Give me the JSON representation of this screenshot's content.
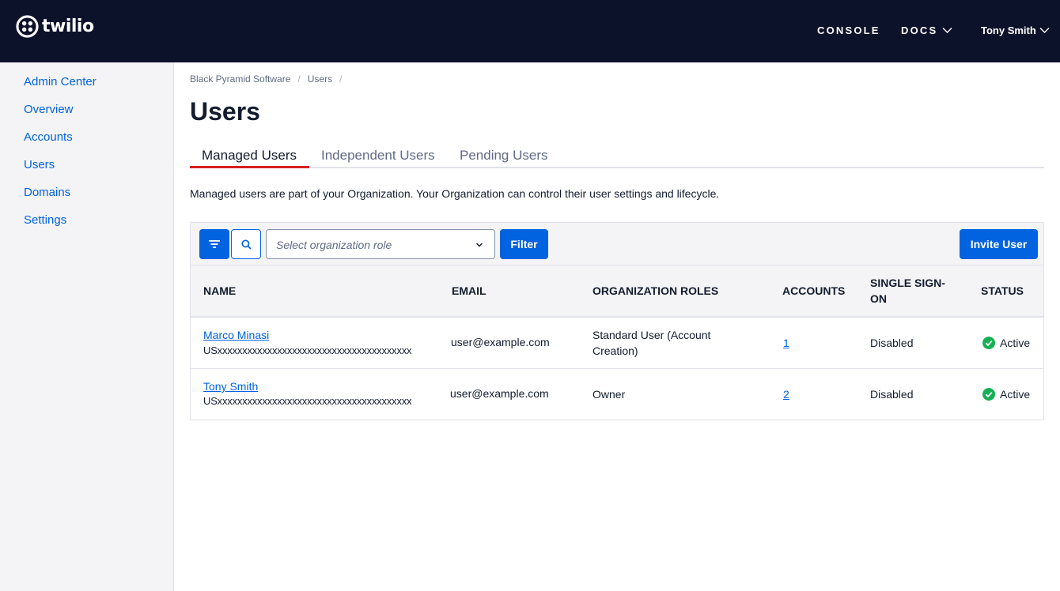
{
  "header": {
    "brand": "twilio",
    "nav": {
      "console": "CONSOLE",
      "docs": "DOCS",
      "user": "Tony Smith"
    }
  },
  "sidebar": {
    "items": [
      {
        "label": "Admin Center"
      },
      {
        "label": "Overview"
      },
      {
        "label": "Accounts"
      },
      {
        "label": "Users"
      },
      {
        "label": "Domains"
      },
      {
        "label": "Settings"
      }
    ]
  },
  "breadcrumb": {
    "items": [
      "Black Pyramid Software",
      "Users"
    ],
    "separator": "/"
  },
  "page": {
    "title": "Users",
    "description": "Managed users are part of your Organization. Your Organization can control their user settings and lifecycle."
  },
  "tabs": [
    {
      "label": "Managed Users",
      "active": true
    },
    {
      "label": "Independent Users",
      "active": false
    },
    {
      "label": "Pending Users",
      "active": false
    }
  ],
  "toolbar": {
    "role_select_placeholder": "Select organization role",
    "filter_label": "Filter",
    "invite_label": "Invite User"
  },
  "table": {
    "columns": {
      "name": "NAME",
      "email": "EMAIL",
      "roles": "ORGANIZATION ROLES",
      "accounts": "ACCOUNTS",
      "sso_line1": "SINGLE SIGN-",
      "sso_line2": "ON",
      "status": "STATUS"
    },
    "rows": [
      {
        "name": "Marco Minasi",
        "sid": "USxxxxxxxxxxxxxxxxxxxxxxxxxxxxxxxxxxxxxxx",
        "email": "user@example.com",
        "role_line1": "Standard User (Account",
        "role_line2": "Creation)",
        "accounts": "1",
        "sso": "Disabled",
        "status": "Active"
      },
      {
        "name": "Tony Smith",
        "sid": "USxxxxxxxxxxxxxxxxxxxxxxxxxxxxxxxxxxxxxxx",
        "email": "user@example.com",
        "role_line1": "Owner",
        "accounts": "2",
        "sso": "Disabled",
        "status": "Active"
      }
    ]
  },
  "colors": {
    "header_bg": "#0d122b",
    "primary": "#0263e0",
    "tab_active_underline": "#d61f1f",
    "status_success": "#14b053"
  },
  "icons": {
    "logo": "twilio-logo-icon",
    "docs_chevron": "chevron-down-icon",
    "user_chevron": "chevron-down-icon",
    "filter_toggle": "filter-icon",
    "search": "search-icon",
    "select_chevron": "chevron-down-icon",
    "status": "check-circle-icon"
  }
}
